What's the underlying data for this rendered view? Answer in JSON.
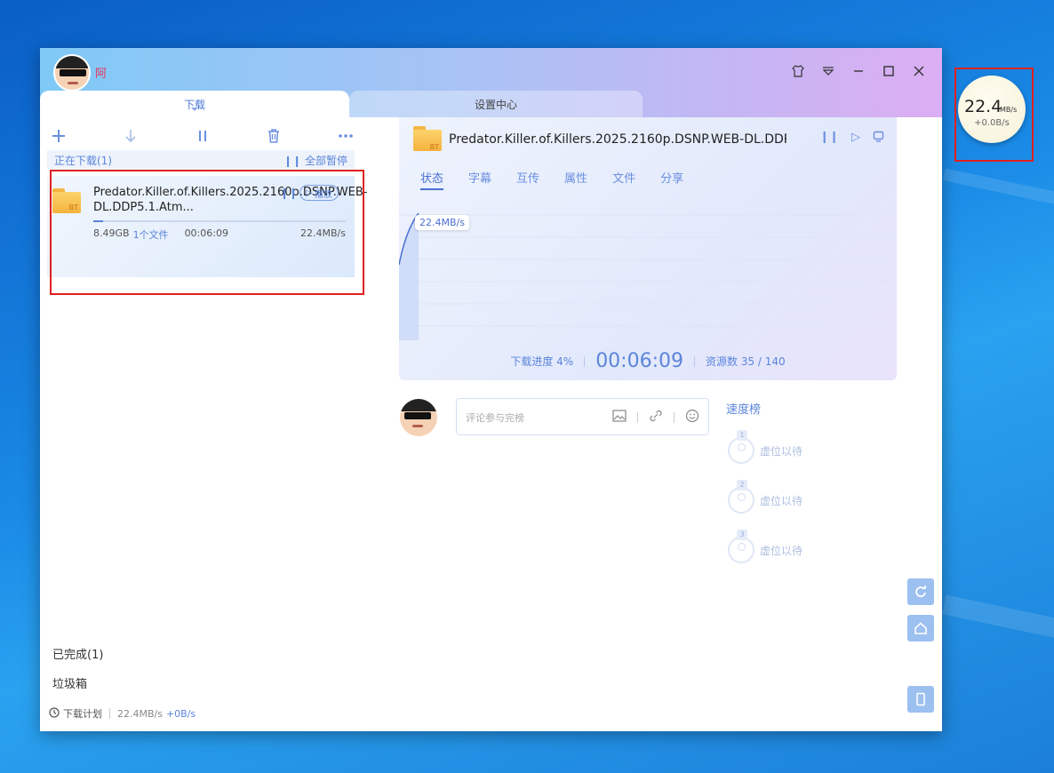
{
  "window": {
    "username": "阿",
    "tabs": [
      {
        "label": "下载"
      },
      {
        "label": "设置中心"
      }
    ]
  },
  "left_pane": {
    "toolbar": {
      "new_icon": "plus-icon",
      "download_icon": "arrow-down-icon",
      "pause_icon": "pause-icon",
      "delete_icon": "trash-icon",
      "more_icon": "more-icon"
    },
    "downloading_header": "正在下载(1)",
    "pause_all": "全部暂停",
    "task": {
      "name": "Predator.Killer.of.Killers.2025.2160p.DSNP.WEB-DL.DDP5.1.Atm...",
      "play_label": "播放",
      "size": "8.49GB",
      "files": "1个文件",
      "elapsed": "00:06:09",
      "speed": "22.4MB/s",
      "progress": 0.04
    },
    "completed": "已完成(1)",
    "trash": "垃圾箱",
    "footer": {
      "schedule": "下载计划",
      "down_speed": "22.4MB/s",
      "up_speed": "+0B/s"
    }
  },
  "detail": {
    "title": "Predator.Killer.of.Killers.2025.2160p.DSNP.WEB-DL.DDP5...",
    "bt_label": "BT",
    "subtabs": [
      "状态",
      "字幕",
      "互传",
      "属性",
      "文件",
      "分享"
    ],
    "active_subtab": "状态",
    "chart": {
      "speed_label": "22.4MB/s"
    },
    "progress_label": "下载进度 4%",
    "elapsed": "00:06:09",
    "resources": "资源数 35 / 140"
  },
  "comments": {
    "placeholder": "评论参与完榜"
  },
  "ranking": {
    "title": "速度榜",
    "items": [
      {
        "rank": "1",
        "label": "虚位以待"
      },
      {
        "rank": "2",
        "label": "虚位以待"
      },
      {
        "rank": "3",
        "label": "虚位以待"
      }
    ]
  },
  "float_widget": {
    "speed": "22.4",
    "unit": "MB/s",
    "up": "+0.0B/s"
  },
  "colors": {
    "accent": "#5b85db",
    "highlight_box": "#e02020"
  }
}
